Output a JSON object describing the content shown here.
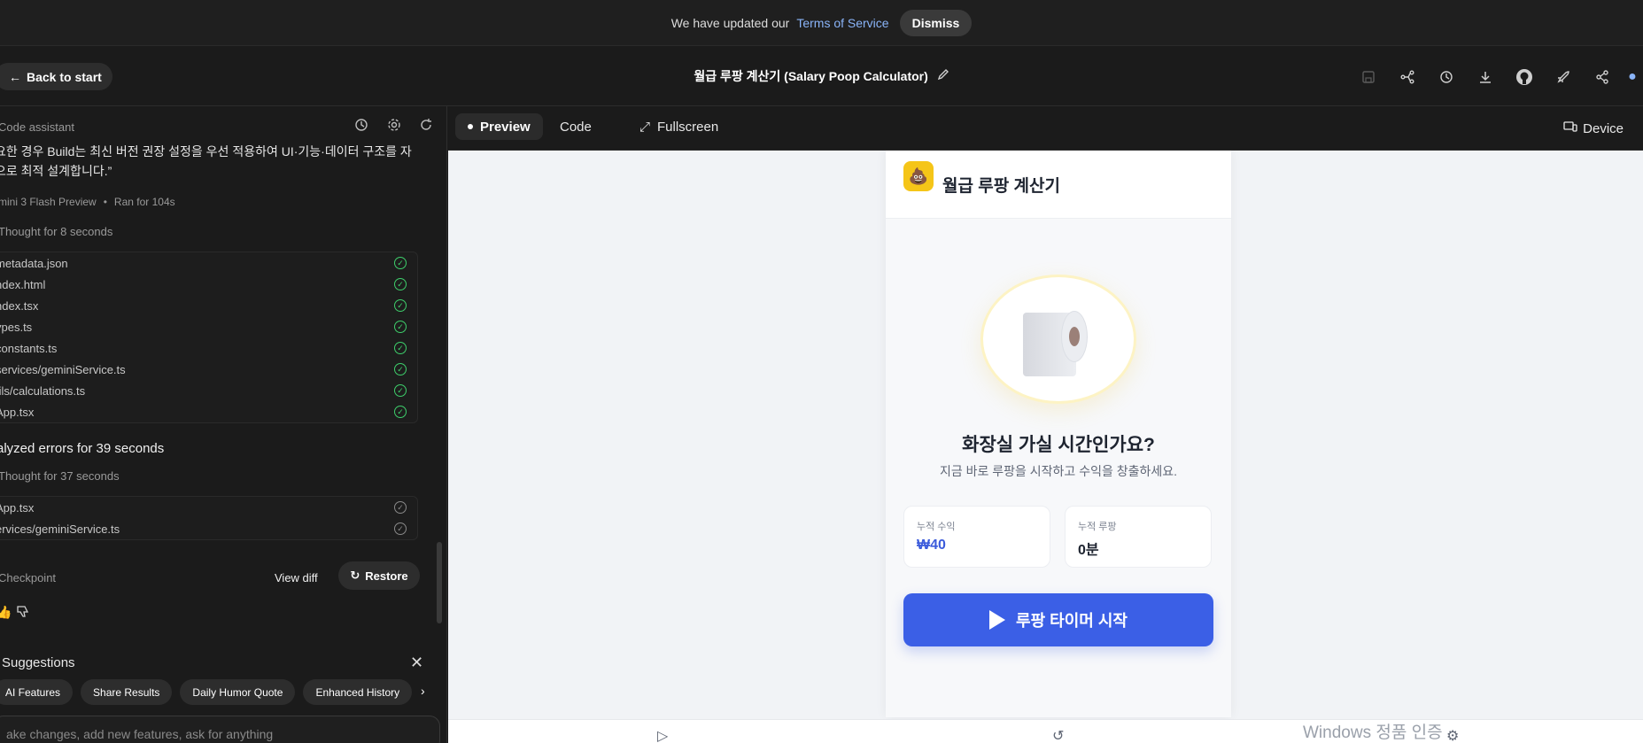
{
  "banner": {
    "text": "We have updated our",
    "link": "Terms of Service",
    "dismiss": "Dismiss"
  },
  "header": {
    "back": "Back to start",
    "title": "월급 루팡 계산기 (Salary Poop Calculator)",
    "icons": [
      "save-icon",
      "fork-icon",
      "history-icon",
      "download-icon",
      "github-icon",
      "deploy-icon",
      "share-icon"
    ]
  },
  "assistant": {
    "label": "Code assistant",
    "paragraph": "요한 경우 Build는 최신 버전 권장 설정을 우선 적용하여 UI·기능·데이터 구조를 자으로 최적 설계합니다.”",
    "model": "mini 3 Flash Preview",
    "ran": "Ran for 104s",
    "thought1": "Thought for 8 seconds",
    "files1": [
      "metadata.json",
      "ndex.html",
      "ndex.tsx",
      "ypes.ts",
      "constants.ts",
      "services/geminiService.ts",
      "tils/calculations.ts",
      "App.tsx"
    ],
    "analyzed": "alyzed errors for 39 seconds",
    "thought2": "Thought for 37 seconds",
    "files2": [
      "App.tsx",
      "ervices/geminiService.ts"
    ],
    "checkpoint": "Checkpoint",
    "view_diff": "View diff",
    "restore": "Restore"
  },
  "suggestions": {
    "title": "Suggestions",
    "chips": [
      "AI Features",
      "Share Results",
      "Daily Humor Quote",
      "Enhanced History"
    ]
  },
  "input": {
    "placeholder": "ake changes, add new features, ask for anything"
  },
  "tabs": {
    "preview": "Preview",
    "code": "Code",
    "fullscreen": "Fullscreen",
    "device": "Device"
  },
  "app": {
    "logo": "💩",
    "title": "월급 루팡 계산기",
    "question": "화장실 가실 시간인가요?",
    "subtitle": "지금 바로 루팡을 시작하고 수익을 창출하세요.",
    "stat1_label": "누적 수익",
    "stat1_value": "₩40",
    "stat2_label": "누적 루팡",
    "stat2_value": "0분",
    "start": "루팡 타이머 시작"
  },
  "watermark": "Windows 정품 인증"
}
